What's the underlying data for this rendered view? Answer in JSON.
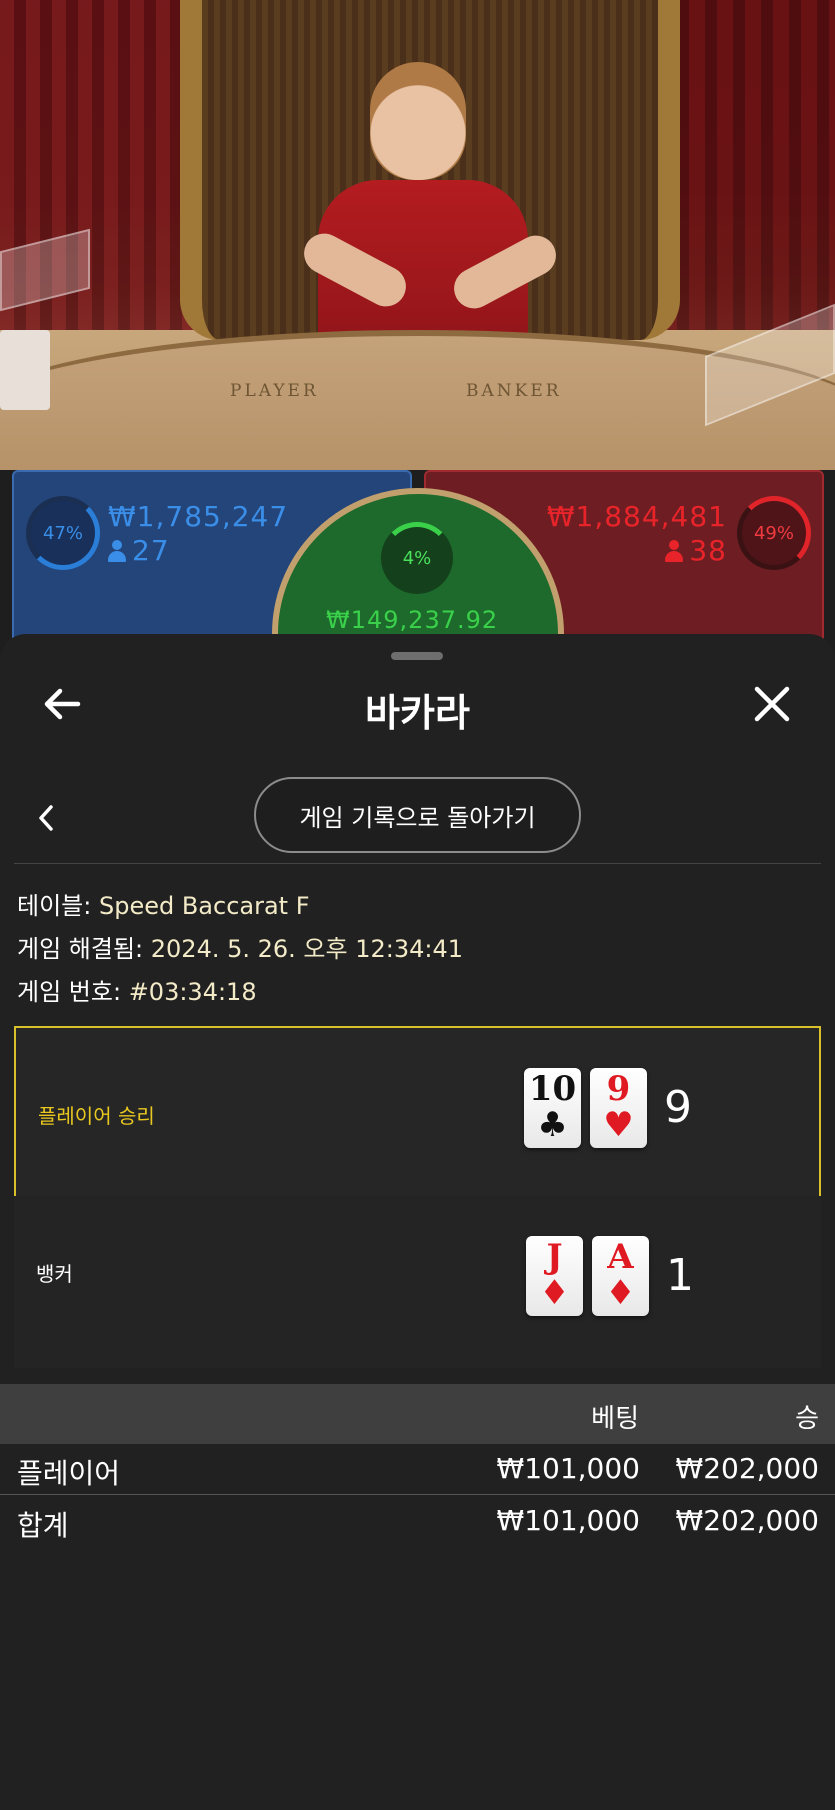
{
  "video": {
    "table_left": "PLAYER",
    "table_right": "BANKER"
  },
  "bets": {
    "player": {
      "percent": "47%",
      "amount": "₩1,785,247",
      "players": "27",
      "color": "#2a7ed8"
    },
    "tie": {
      "percent": "4%",
      "amount": "₩149,237.92",
      "color": "#3ad04a"
    },
    "banker": {
      "percent": "49%",
      "amount": "₩1,884,481",
      "players": "38",
      "color": "#e0242a"
    }
  },
  "sheet": {
    "title": "바카라",
    "back_icon": "arrow-left-icon",
    "close_icon": "close-icon",
    "history_button": "게임 기록으로 돌아가기",
    "info": {
      "table_label": "테이블:",
      "table_value": "Speed Baccarat F",
      "resolved_label": "게임 해결됨:",
      "resolved_value": "2024. 5. 26. 오후 12:34:41",
      "number_label": "게임 번호:",
      "number_value": "#03:34:18"
    },
    "results": {
      "player": {
        "label": "플레이어 승리",
        "cards": [
          {
            "rank": "10",
            "suit": "♣",
            "color": "black"
          },
          {
            "rank": "9",
            "suit": "♥",
            "color": "red"
          }
        ],
        "score": "9"
      },
      "banker": {
        "label": "뱅커",
        "cards": [
          {
            "rank": "J",
            "suit": "♦",
            "color": "red"
          },
          {
            "rank": "A",
            "suit": "♦",
            "color": "red"
          }
        ],
        "score": "1"
      }
    },
    "bet_table": {
      "headers": {
        "bet": "베팅",
        "win": "승"
      },
      "rows": [
        {
          "name": "플레이어",
          "bet": "₩101,000",
          "win": "₩202,000"
        },
        {
          "name": "합계",
          "bet": "₩101,000",
          "win": "₩202,000"
        }
      ]
    }
  }
}
